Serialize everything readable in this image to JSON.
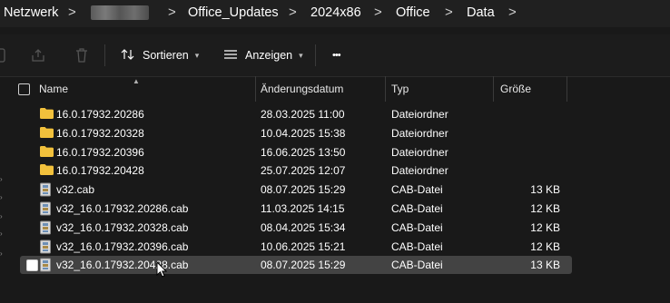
{
  "breadcrumb": {
    "items": [
      "Netzwerk",
      "Office_Updates",
      "2024x86",
      "Office",
      "Data"
    ],
    "separator": ">"
  },
  "toolbar": {
    "sort_label": "Sortieren",
    "view_label": "Anzeigen",
    "more_label": "•••"
  },
  "columns": {
    "name": "Name",
    "date": "Änderungsdatum",
    "type": "Typ",
    "size": "Größe"
  },
  "files": [
    {
      "name": "16.0.17932.20286",
      "date": "28.03.2025 11:00",
      "type": "Dateiordner",
      "size": "",
      "kind": "folder"
    },
    {
      "name": "16.0.17932.20328",
      "date": "10.04.2025 15:38",
      "type": "Dateiordner",
      "size": "",
      "kind": "folder"
    },
    {
      "name": "16.0.17932.20396",
      "date": "16.06.2025 13:50",
      "type": "Dateiordner",
      "size": "",
      "kind": "folder"
    },
    {
      "name": "16.0.17932.20428",
      "date": "25.07.2025 12:07",
      "type": "Dateiordner",
      "size": "",
      "kind": "folder"
    },
    {
      "name": "v32.cab",
      "date": "08.07.2025 15:29",
      "type": "CAB-Datei",
      "size": "13 KB",
      "kind": "cab"
    },
    {
      "name": "v32_16.0.17932.20286.cab",
      "date": "11.03.2025 14:15",
      "type": "CAB-Datei",
      "size": "12 KB",
      "kind": "cab"
    },
    {
      "name": "v32_16.0.17932.20328.cab",
      "date": "08.04.2025 15:34",
      "type": "CAB-Datei",
      "size": "12 KB",
      "kind": "cab"
    },
    {
      "name": "v32_16.0.17932.20396.cab",
      "date": "10.06.2025 15:21",
      "type": "CAB-Datei",
      "size": "12 KB",
      "kind": "cab"
    },
    {
      "name": "v32_16.0.17932.20428.cab",
      "date": "08.07.2025 15:29",
      "type": "CAB-Datei",
      "size": "13 KB",
      "kind": "cab",
      "selected": true
    }
  ],
  "colors": {
    "background": "#191919",
    "folder": "#f2c13c",
    "selection": "#434343"
  }
}
